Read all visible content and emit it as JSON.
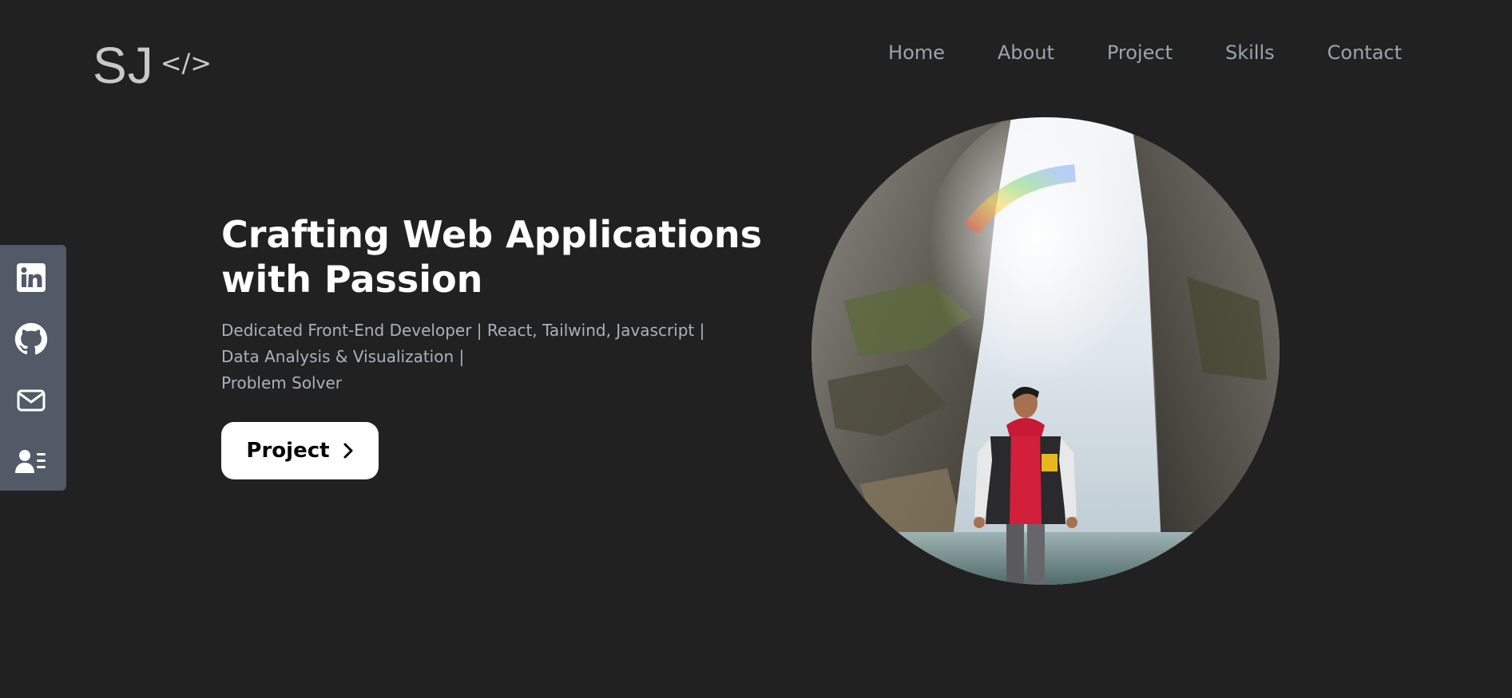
{
  "header": {
    "logo_text": "SJ",
    "logo_code": "</>",
    "nav": [
      {
        "label": "Home"
      },
      {
        "label": "About"
      },
      {
        "label": "Project"
      },
      {
        "label": "Skills"
      },
      {
        "label": "Contact"
      }
    ]
  },
  "social": {
    "items": [
      {
        "icon": "linkedin-icon"
      },
      {
        "icon": "github-icon"
      },
      {
        "icon": "mail-icon"
      },
      {
        "icon": "resume-icon"
      }
    ],
    "background_color": "#525a68"
  },
  "hero": {
    "title_line1": "Crafting Web Applications",
    "title_line2": "with Passion",
    "subtitle_line1": "Dedicated Front-End Developer | React, Tailwind, Javascript |",
    "subtitle_line2": "Data Analysis & Visualization |",
    "subtitle_line3": "Problem Solver",
    "cta_label": "Project"
  },
  "colors": {
    "background": "#212121",
    "nav_text": "#9ca3af",
    "subtitle_text": "#aab1bd",
    "cta_background": "#ffffff"
  }
}
